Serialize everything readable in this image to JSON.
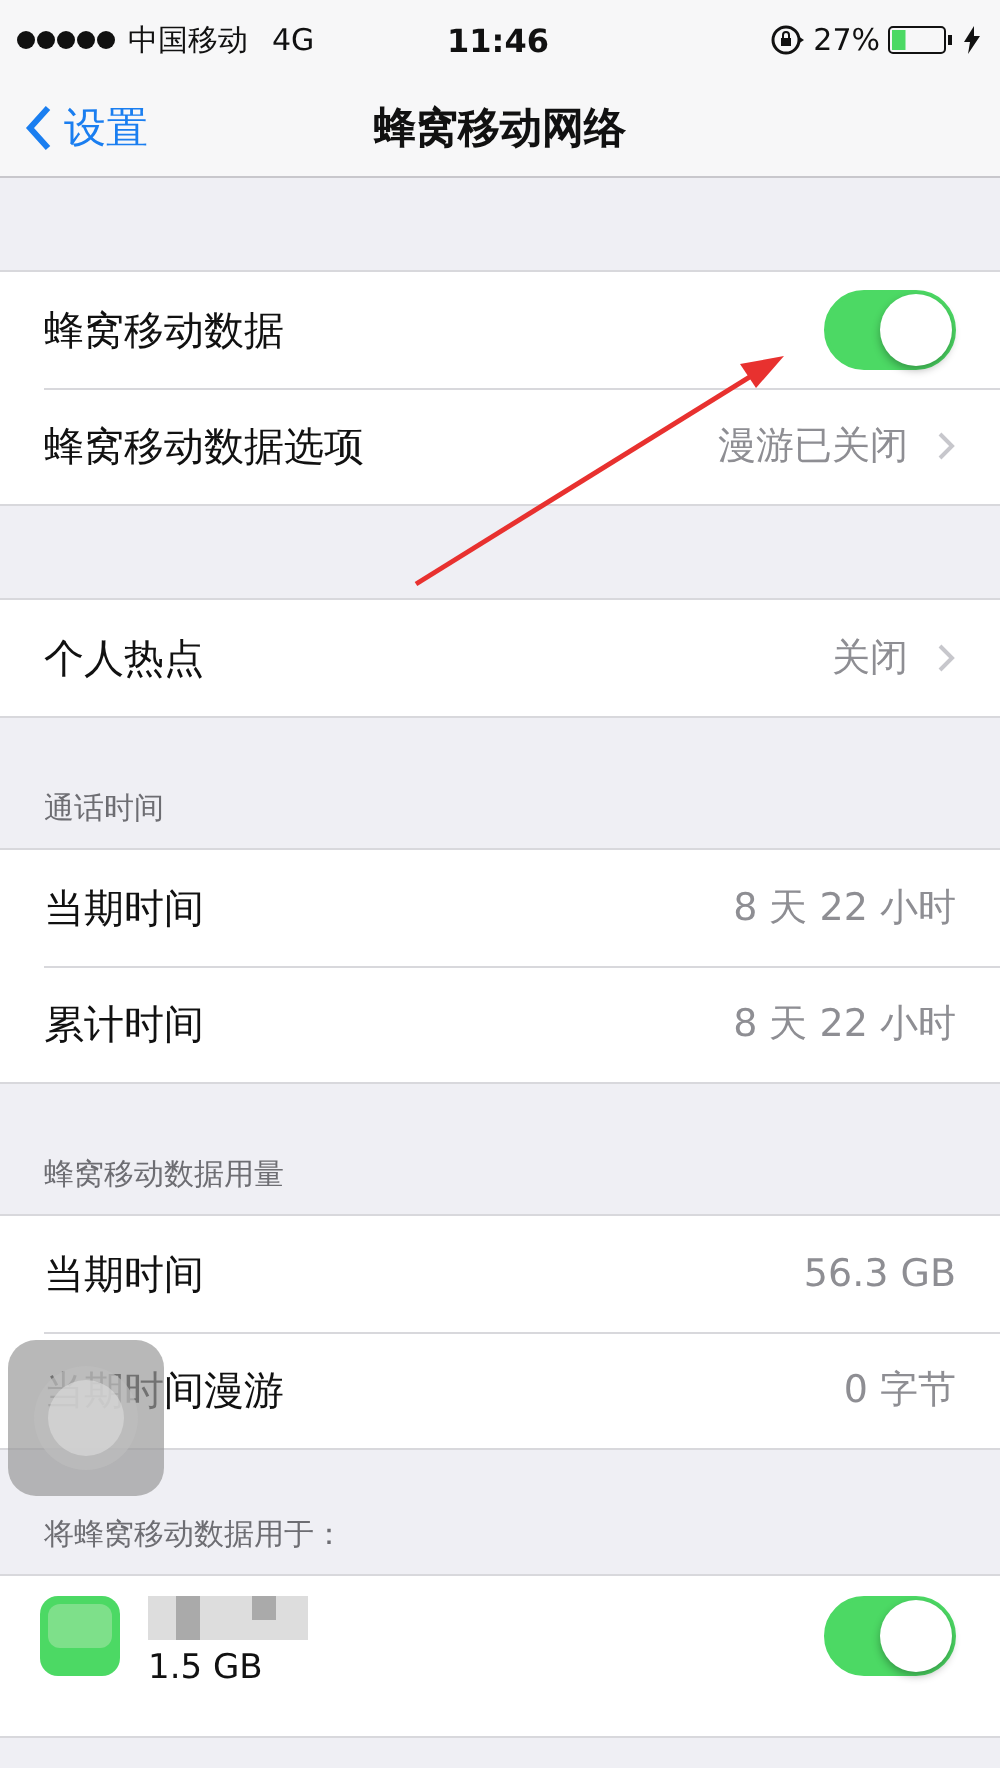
{
  "status_bar": {
    "carrier": "中国移动",
    "network": "4G",
    "time": "11:46",
    "battery": "27%",
    "battery_meter": {
      "level": 0.27
    }
  },
  "nav_bar": {
    "back": "设置",
    "title": "蜂窝移动网络"
  },
  "groups": [
    {
      "rows": [
        {
          "kind": "toggle",
          "label": "蜂窝移动数据",
          "on": true
        },
        {
          "kind": "link",
          "label": "蜂窝移动数据选项",
          "value": "漫游已关闭"
        }
      ]
    },
    {
      "rows": [
        {
          "kind": "link",
          "label": "个人热点",
          "value": "关闭"
        }
      ]
    },
    {
      "header": "通话时间",
      "rows": [
        {
          "kind": "value",
          "label": "当期时间",
          "value": "8 天 22 小时"
        },
        {
          "kind": "value",
          "label": "累计时间",
          "value": "8 天 22 小时"
        }
      ]
    },
    {
      "header": "蜂窝移动数据用量",
      "rows": [
        {
          "kind": "value",
          "label": "当期时间",
          "value": "56.3 GB"
        },
        {
          "kind": "value",
          "label": "当期时间漫游",
          "value": "0 字节"
        }
      ]
    },
    {
      "header": "将蜂窝移动数据用于：",
      "rows": [
        {
          "kind": "app",
          "detail": "1.5 GB",
          "on": true
        }
      ]
    }
  ],
  "overlays": [
    {
      "kind": "arrow"
    },
    {
      "kind": "assistive-touch"
    }
  ]
}
